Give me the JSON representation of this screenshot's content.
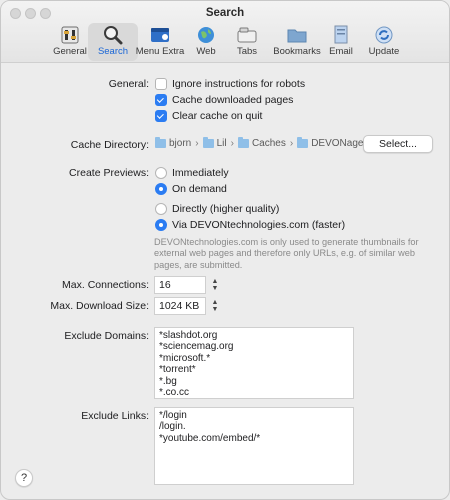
{
  "window": {
    "title": "Search"
  },
  "toolbar": {
    "items": [
      {
        "label": "General",
        "icon": "switches-icon"
      },
      {
        "label": "Search",
        "icon": "magnifier-icon",
        "selected": true
      },
      {
        "label": "Menu Extra",
        "icon": "menu-extra-icon"
      },
      {
        "label": "Web",
        "icon": "globe-icon"
      },
      {
        "label": "Tabs",
        "icon": "tabs-icon"
      },
      {
        "label": "Bookmarks",
        "icon": "folder-icon"
      },
      {
        "label": "Email",
        "icon": "email-icon"
      },
      {
        "label": "Update",
        "icon": "update-icon"
      }
    ]
  },
  "general": {
    "label": "General:",
    "options": [
      {
        "label": "Ignore instructions for robots",
        "checked": false
      },
      {
        "label": "Cache downloaded pages",
        "checked": true
      },
      {
        "label": "Clear cache on quit",
        "checked": true
      }
    ]
  },
  "cache": {
    "label": "Cache Directory:",
    "path": [
      "bjorn",
      "Lil",
      "Caches",
      "DEVONagent"
    ],
    "select_button": "Select..."
  },
  "previews": {
    "label": "Create Previews:",
    "timing": [
      {
        "label": "Immediately",
        "checked": false
      },
      {
        "label": "On demand",
        "checked": true
      }
    ],
    "method": [
      {
        "label": "Directly (higher quality)",
        "checked": false
      },
      {
        "label": "Via DEVONtechnologies.com (faster)",
        "checked": true
      }
    ],
    "note": "DEVONtechnologies.com is only used to generate thumbnails for external web pages and therefore only URLs, e.g. of similar web pages, are submitted."
  },
  "connections": {
    "label": "Max. Connections:",
    "value": "16"
  },
  "download": {
    "label": "Max. Download Size:",
    "value": "1024 KB"
  },
  "exclude_domains": {
    "label": "Exclude Domains:",
    "lines": [
      "*slashdot.org",
      "*sciencemag.org",
      "*microsoft.*",
      "*torrent*",
      "*.bg",
      "*.co.cc"
    ]
  },
  "exclude_links": {
    "label": "Exclude Links:",
    "lines": [
      "*/login",
      "/login.",
      "*youtube.com/embed/*"
    ]
  },
  "help": {
    "label": "?"
  },
  "colors": {
    "accent": "#2b7cf2",
    "selected_label": "#1a66d6"
  }
}
